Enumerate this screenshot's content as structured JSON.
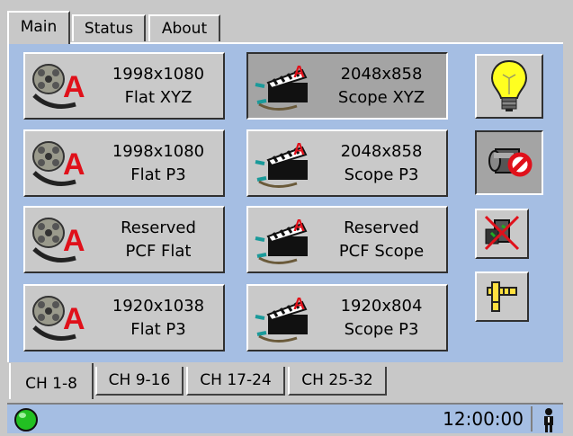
{
  "top_tabs": [
    {
      "label": "Main",
      "active": true
    },
    {
      "label": "Status",
      "active": false
    },
    {
      "label": "About",
      "active": false
    }
  ],
  "presets": [
    {
      "line1": "1998x1080",
      "line2": "Flat XYZ",
      "icon": "film-reel-flat-icon",
      "pressed": false
    },
    {
      "line1": "2048x858",
      "line2": "Scope XYZ",
      "icon": "film-scope-icon",
      "pressed": true
    },
    {
      "line1": "1998x1080",
      "line2": "Flat P3",
      "icon": "film-reel-flat-icon",
      "pressed": false
    },
    {
      "line1": "2048x858",
      "line2": "Scope P3",
      "icon": "film-scope-icon",
      "pressed": false
    },
    {
      "line1": "Reserved",
      "line2": "PCF Flat",
      "icon": "film-reel-flat-icon",
      "pressed": false
    },
    {
      "line1": "Reserved",
      "line2": "PCF Scope",
      "icon": "film-scope-icon",
      "pressed": false
    },
    {
      "line1": "1920x1038",
      "line2": "Flat P3",
      "icon": "film-reel-flat-icon",
      "pressed": false
    },
    {
      "line1": "1920x804",
      "line2": "Scope P3",
      "icon": "film-scope-icon",
      "pressed": false
    }
  ],
  "side_buttons": [
    {
      "icon": "lightbulb-icon",
      "pressed": false
    },
    {
      "icon": "projector-disabled-icon",
      "pressed": true
    },
    {
      "icon": "no-projector-icon",
      "pressed": false
    },
    {
      "icon": "focus-tool-icon",
      "pressed": false
    }
  ],
  "channel_tabs": [
    {
      "label": "CH 1-8",
      "active": true
    },
    {
      "label": "CH 9-16",
      "active": false
    },
    {
      "label": "CH 17-24",
      "active": false
    },
    {
      "label": "CH 25-32",
      "active": false
    }
  ],
  "status": {
    "time": "12:00:00",
    "indicator_color": "#22c022",
    "indicator_icon": "status-led-icon",
    "user_icon": "user-icon"
  },
  "colors": {
    "panel": "#a5bee3",
    "button": "#c9c9c9",
    "button_pressed": "#a4a4a4",
    "accent_red": "#e0101a"
  }
}
